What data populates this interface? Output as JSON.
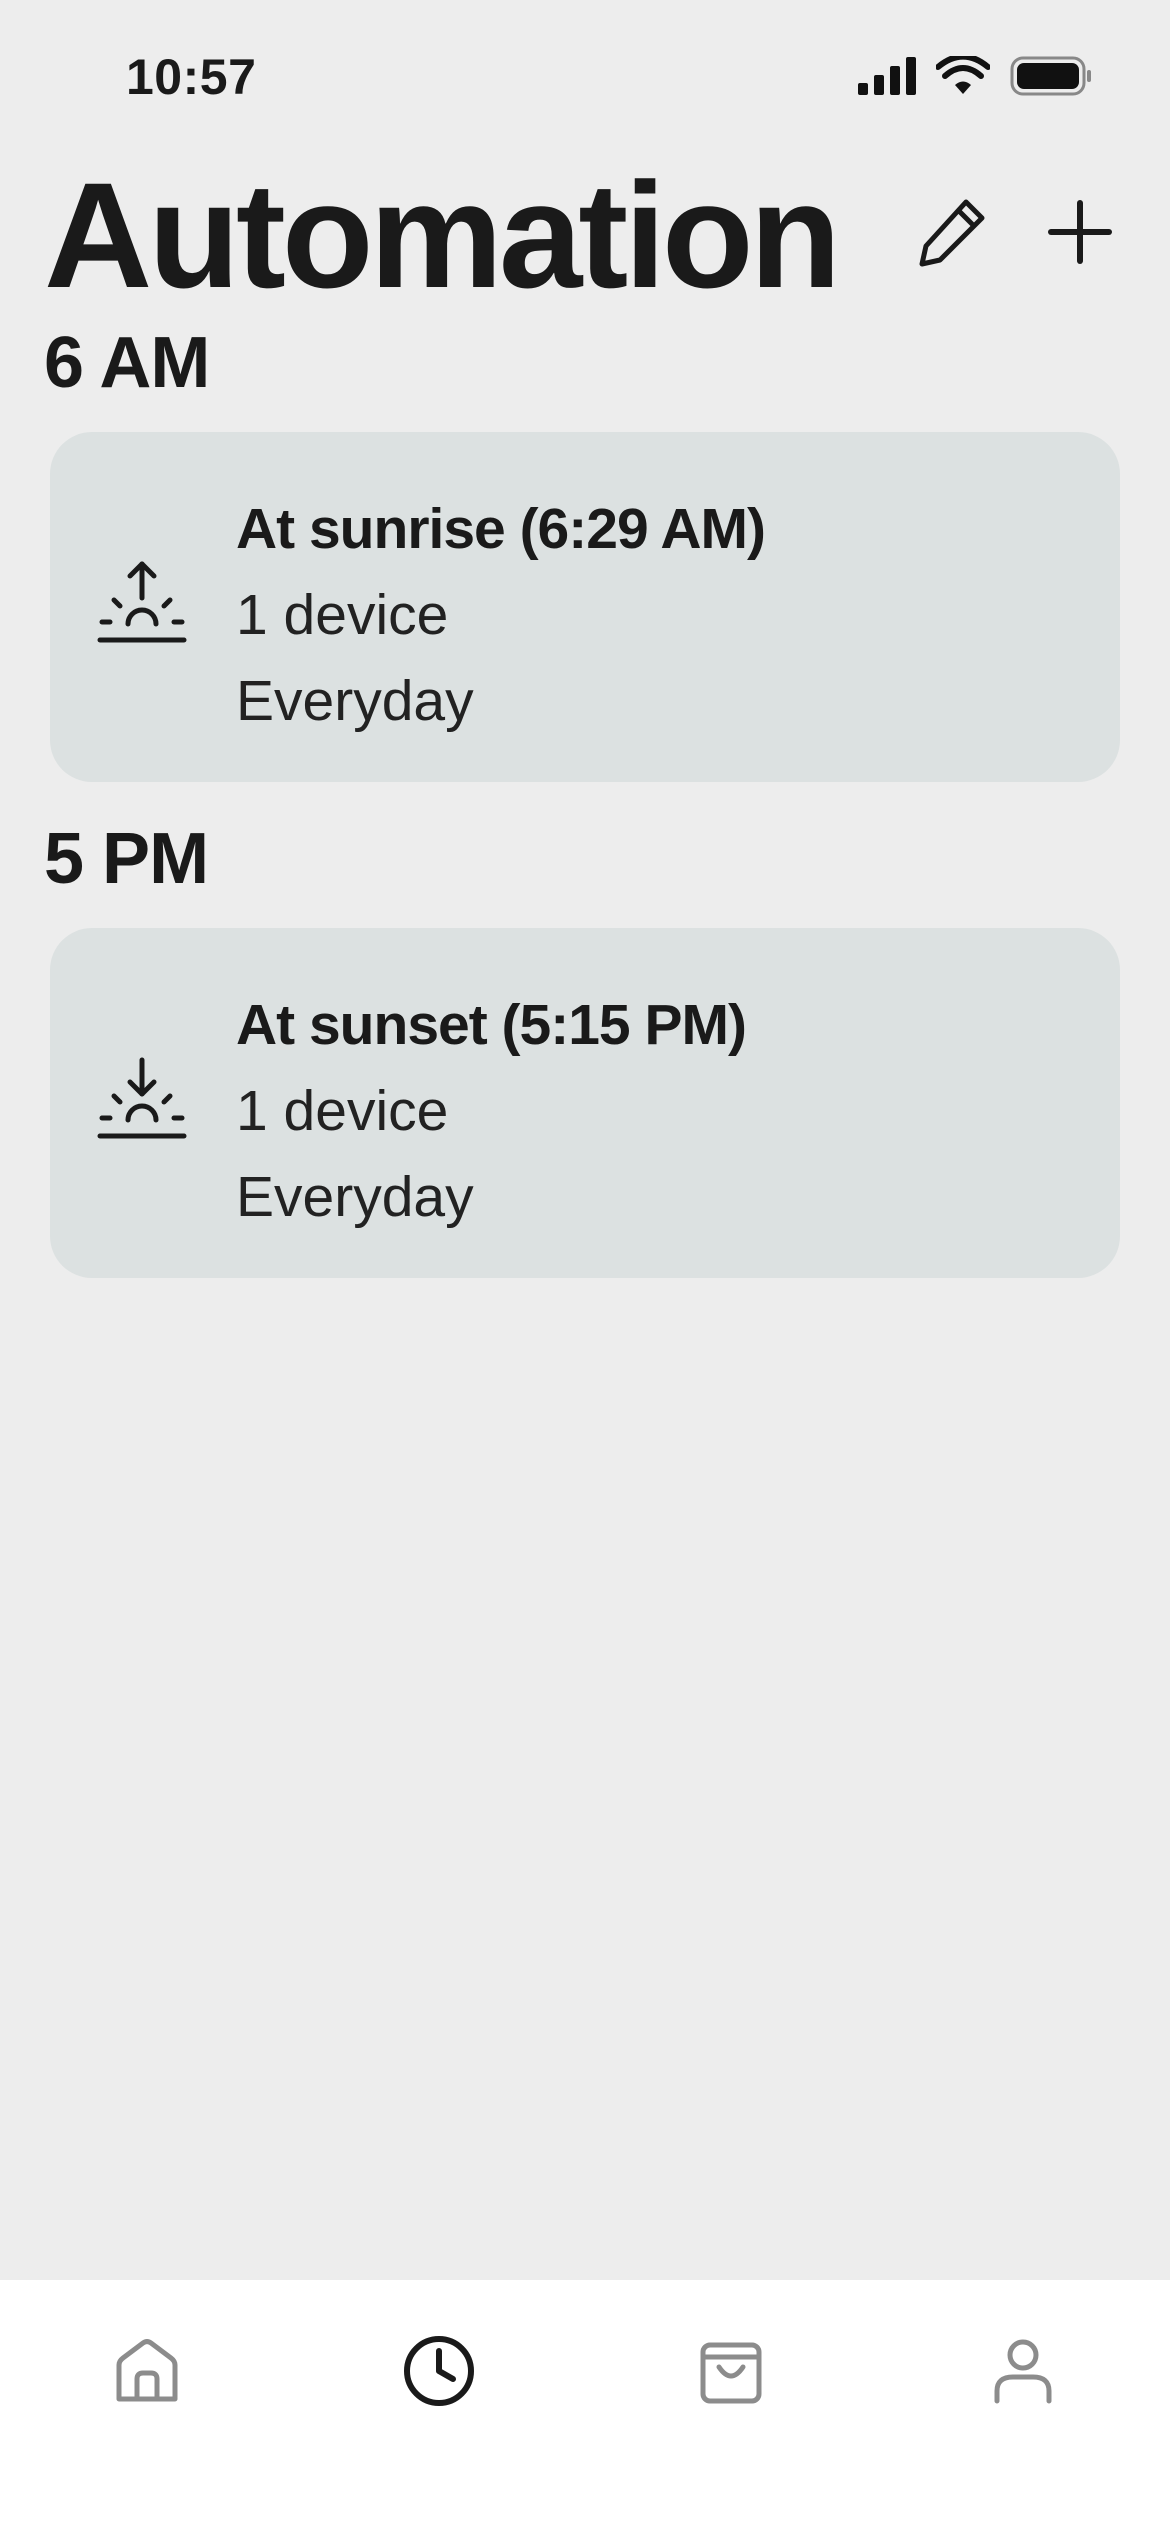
{
  "status": {
    "time": "10:57"
  },
  "header": {
    "title": "Automation"
  },
  "sections": [
    {
      "heading": "6 AM",
      "card": {
        "icon": "sunrise-icon",
        "title": "At sunrise (6:29 AM)",
        "devices": "1 device",
        "repeat": "Everyday"
      }
    },
    {
      "heading": "5 PM",
      "card": {
        "icon": "sunset-icon",
        "title": "At sunset (5:15 PM)",
        "devices": "1 device",
        "repeat": "Everyday"
      }
    }
  ],
  "tabs": [
    {
      "icon": "home-icon",
      "active": false
    },
    {
      "icon": "clock-icon",
      "active": true
    },
    {
      "icon": "shopping-bag-icon",
      "active": false
    },
    {
      "icon": "profile-icon",
      "active": false
    }
  ],
  "colors": {
    "background": "#EDEDED",
    "card": "#DCE1E1",
    "text": "#1A1A1A",
    "tab_inactive": "#8C8C8C"
  }
}
